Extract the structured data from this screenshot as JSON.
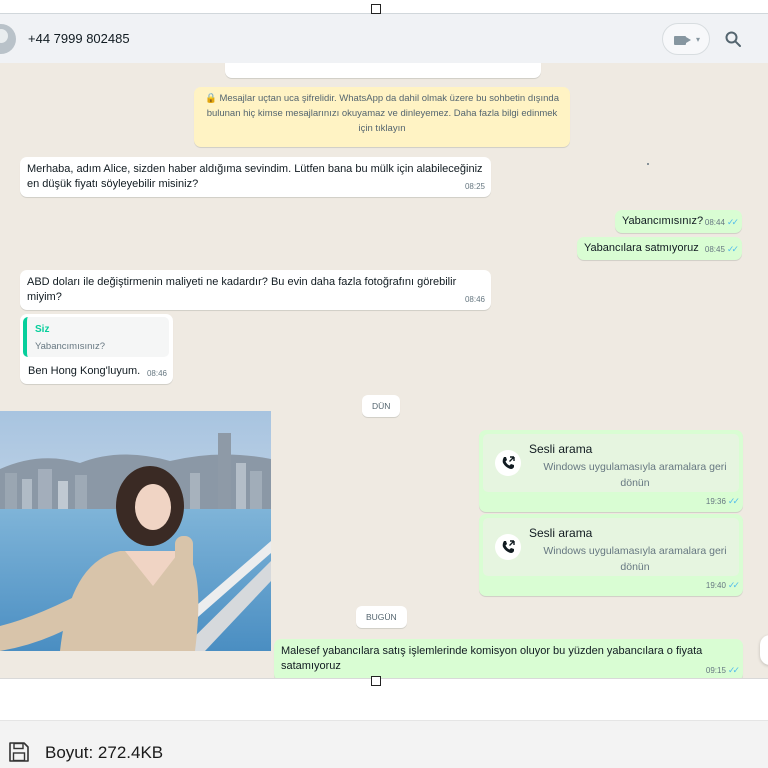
{
  "header": {
    "contact": "+44 7999 802485",
    "video_icon": "video-camera-icon",
    "chevron": "▾",
    "search_icon": "search-icon"
  },
  "chat": {
    "encryption_notice": "🔒 Mesajlar uçtan uca şifrelidir. WhatsApp da dahil olmak üzere bu sohbetin dışında bulunan hiç kimse mesajlarınızı okuyamaz ve dinleyemez. Daha fazla bilgi edinmek için tıklayın",
    "msg1": {
      "text": "Merhaba, adım Alice, sizden haber aldığıma sevindim. Lütfen bana bu mülk için alabileceğiniz en düşük fiyatı söyleyebilir misiniz?",
      "time": "08:25"
    },
    "msg2": {
      "text": "Yabancımısınız?",
      "time": "08:44"
    },
    "msg3": {
      "text": "Yabancılara satmıyoruz",
      "time": "08:45"
    },
    "msg4": {
      "text": "ABD doları ile değiştirmenin maliyeti ne kadardır? Bu evin daha fazla fotoğrafını görebilir miyim?",
      "time": "08:46"
    },
    "msg5": {
      "quote_author": "Siz",
      "quote_text": "Yabancımısınız?",
      "text": "Ben Hong Kong'luyum.",
      "time": "08:46"
    },
    "date_yesterday": "DÜN",
    "call1": {
      "title": "Sesli arama",
      "subtitle": "Windows uygulamasıyla aramalara geri dönün",
      "time": "19:36"
    },
    "call2": {
      "title": "Sesli arama",
      "subtitle": "Windows uygulamasıyla aramalara geri dönün",
      "time": "19:40"
    },
    "date_today": "BUGÜN",
    "msg6": {
      "text": "Malesef yabancılara satış işlemlerinde komisyon oluyor bu yüzden yabancılara  o fiyata satamıyoruz",
      "time": "09:15"
    },
    "ticks": "✓✓"
  },
  "status": {
    "size_label": "Boyut: 272.4KB",
    "save_icon": "floppy-disk-icon"
  },
  "colors": {
    "chat_bg": "#efeae2",
    "outgoing": "#d9fdd3",
    "incoming": "#ffffff",
    "notice": "#fff3c4",
    "quote_accent": "#06cf9c",
    "tick_blue": "#53bdeb"
  }
}
